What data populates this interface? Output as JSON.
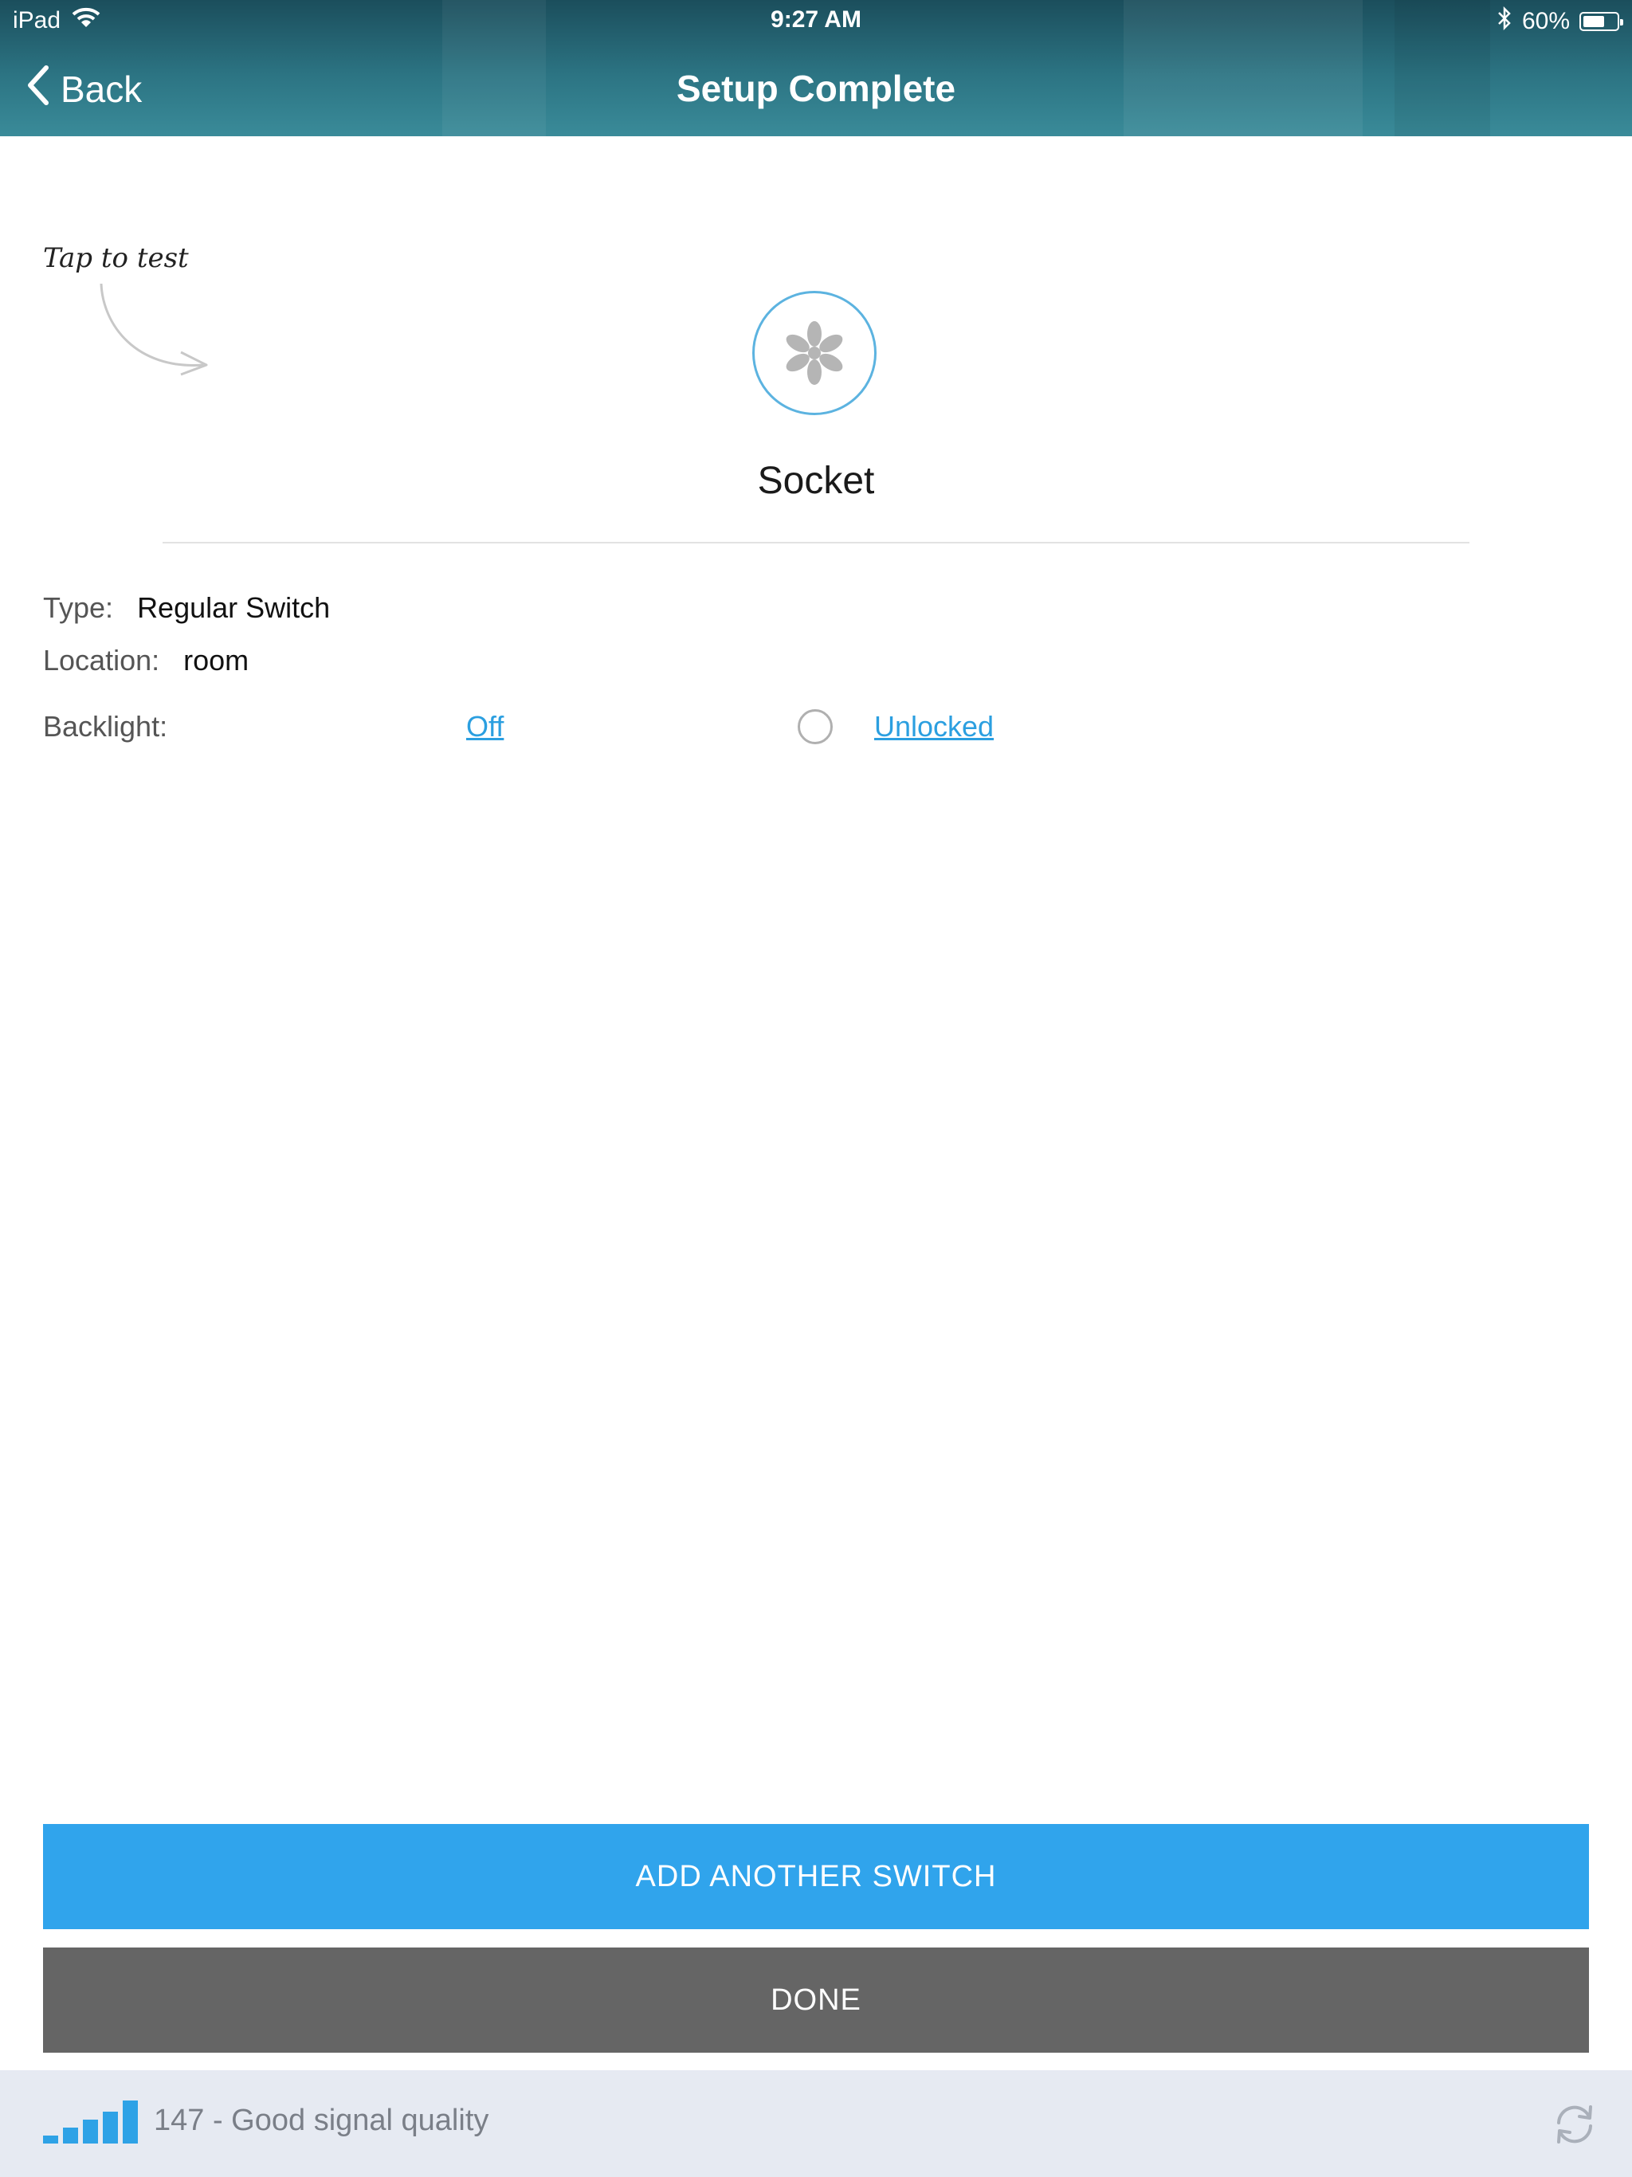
{
  "status_bar": {
    "device": "iPad",
    "time": "9:27 AM",
    "battery": "60%",
    "battery_level": 0.6,
    "icons": [
      "wifi-icon",
      "bluetooth-icon",
      "battery-icon"
    ]
  },
  "nav": {
    "back_label": "Back",
    "title": "Setup Complete"
  },
  "hint": "Tap to test",
  "device": {
    "name": "Socket",
    "icon": "fan-icon"
  },
  "details": {
    "type_label": "Type:",
    "type_value": "Regular Switch",
    "location_label": "Location:",
    "location_value": "room",
    "backlight_label": "Backlight:",
    "backlight_value": "Off",
    "lock_value": "Unlocked"
  },
  "buttons": {
    "add_another": "ADD ANOTHER SWITCH",
    "done": "DONE"
  },
  "footer": {
    "signal_text": "147 - Good signal quality",
    "signal_bars": 5
  },
  "colors": {
    "accent": "#30a4ec",
    "link": "#2b9fe0",
    "done_button": "#656565",
    "footer_bg": "#e6eaf2",
    "header_teal": "#2c7483"
  }
}
